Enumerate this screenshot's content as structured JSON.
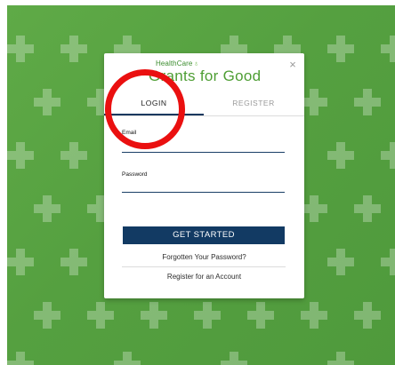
{
  "brand": {
    "small": "HealthCare",
    "leaf": "♁",
    "large": "Grants for Good"
  },
  "modal": {
    "close_label": "×",
    "tabs": [
      "LOGIN",
      "REGISTER"
    ],
    "email_label": "Email",
    "password_label": "Password",
    "cta_label": "GET STARTED",
    "forgot_link": "Forgotten Your Password?",
    "register_link": "Register for an Account"
  },
  "colors": {
    "background_green": "#55a040",
    "primary_navy": "#123a63",
    "brand_green": "#4e9e34",
    "highlight_red": "#ea1010"
  }
}
